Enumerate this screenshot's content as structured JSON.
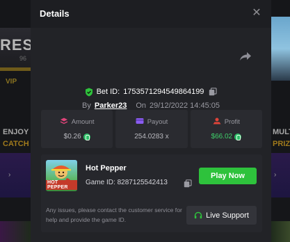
{
  "background": {
    "left_banner_text": "RES",
    "left_banner_sub": "96",
    "left_vip": "VIP",
    "left_promo_1": "ENJOY",
    "left_promo_2": "CATCH",
    "right_promo_1": "MULT",
    "right_promo_2": "PRIZE"
  },
  "modal": {
    "title": "Details",
    "close_label": "✕",
    "bet_id_label": "Bet ID:",
    "bet_id": "1753571294549864199",
    "by_label": "By",
    "username": "Parker23",
    "on_label": "On",
    "timestamp": "29/12/2022 14:45:05"
  },
  "stats": [
    {
      "label": "Amount",
      "value": "$0.26",
      "icon": "money-icon",
      "icon_color": "#e0447a",
      "has_coin": true,
      "green": false
    },
    {
      "label": "Payout",
      "value": "254.0283 x",
      "icon": "wallet-icon",
      "icon_color": "#8a5cf0",
      "has_coin": false,
      "green": false
    },
    {
      "label": "Profit",
      "value": "$66.02",
      "icon": "profit-icon",
      "icon_color": "#e0443a",
      "has_coin": true,
      "green": true
    }
  ],
  "game": {
    "name": "Hot Pepper",
    "id_label": "Game ID:",
    "id": "8287125542413",
    "thumb_tag": "HOT PEPPER",
    "play_label": "Play Now",
    "help_text": "Any issues, please contact the customer service for help and provide the game ID.",
    "support_label": "Live Support"
  },
  "colors": {
    "accent_green": "#2ec23c",
    "profit_green": "#3ecf6a"
  }
}
